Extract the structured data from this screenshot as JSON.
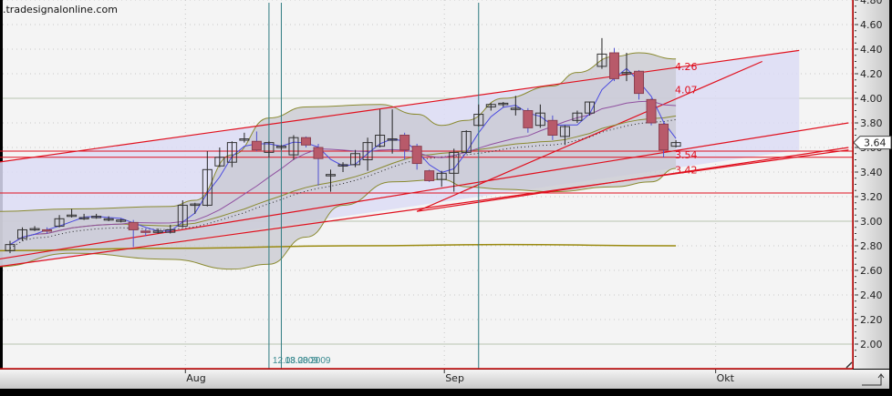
{
  "watermark": ".tradesignalonline.com",
  "chart_data": {
    "type": "candlestick",
    "y_axis": {
      "min": 1.8,
      "max": 4.8,
      "ticks": [
        2.0,
        2.2,
        2.4,
        2.6,
        2.8,
        3.0,
        3.2,
        3.4,
        3.6,
        3.8,
        4.0,
        4.2,
        4.4,
        4.6,
        4.8
      ],
      "position": "right"
    },
    "x_axis": {
      "month_labels": [
        {
          "label": "Aug",
          "date": "2009-08-03"
        },
        {
          "label": "Sep",
          "date": "2009-09-01"
        },
        {
          "label": "Okt",
          "date": "2009-10-01"
        }
      ]
    },
    "last_price": "3.64",
    "colors": {
      "bull": "#ffffff00",
      "bear": "#b85a6a",
      "trend": "#e0101e",
      "vline": "#2e7a80",
      "bb_fill": "#c8c8d0",
      "channel_fill": "#dcdcf5",
      "ma_fast": "#4a4ae0",
      "ma_mid": "#9050a0",
      "ma_slow": "#8a8a30"
    },
    "candles": [
      {
        "d": "2009-07-14",
        "ohlc": [
          2.76,
          2.84,
          2.74,
          2.81
        ]
      },
      {
        "d": "2009-07-15",
        "ohlc": [
          2.86,
          2.95,
          2.84,
          2.93
        ]
      },
      {
        "d": "2009-07-16",
        "ohlc": [
          2.93,
          2.96,
          2.92,
          2.94
        ]
      },
      {
        "d": "2009-07-17",
        "ohlc": [
          2.93,
          2.95,
          2.9,
          2.92
        ]
      },
      {
        "d": "2009-07-20",
        "ohlc": [
          2.96,
          3.05,
          2.95,
          3.02
        ]
      },
      {
        "d": "2009-07-21",
        "ohlc": [
          3.04,
          3.1,
          3.03,
          3.05
        ]
      },
      {
        "d": "2009-07-22",
        "ohlc": [
          3.03,
          3.06,
          3.01,
          3.03
        ]
      },
      {
        "d": "2009-07-23",
        "ohlc": [
          3.03,
          3.06,
          3.02,
          3.04
        ]
      },
      {
        "d": "2009-07-24",
        "ohlc": [
          3.02,
          3.04,
          3.0,
          3.02
        ]
      },
      {
        "d": "2009-07-27",
        "ohlc": [
          3.01,
          3.02,
          2.99,
          3.01
        ]
      },
      {
        "d": "2009-07-28",
        "ohlc": [
          2.99,
          3.01,
          2.79,
          2.93
        ]
      },
      {
        "d": "2009-07-29",
        "ohlc": [
          2.92,
          2.94,
          2.88,
          2.91
        ]
      },
      {
        "d": "2009-07-30",
        "ohlc": [
          2.91,
          2.94,
          2.9,
          2.92
        ]
      },
      {
        "d": "2009-07-31",
        "ohlc": [
          2.91,
          2.97,
          2.9,
          2.93
        ]
      },
      {
        "d": "2009-08-03",
        "ohlc": [
          2.96,
          3.17,
          2.95,
          3.13
        ]
      },
      {
        "d": "2009-08-04",
        "ohlc": [
          3.13,
          3.15,
          3.06,
          3.14
        ]
      },
      {
        "d": "2009-08-05",
        "ohlc": [
          3.13,
          3.57,
          3.12,
          3.42
        ]
      },
      {
        "d": "2009-08-06",
        "ohlc": [
          3.45,
          3.6,
          3.44,
          3.52
        ]
      },
      {
        "d": "2009-08-07",
        "ohlc": [
          3.48,
          3.65,
          3.44,
          3.64
        ]
      },
      {
        "d": "2009-08-10",
        "ohlc": [
          3.66,
          3.72,
          3.64,
          3.67
        ]
      },
      {
        "d": "2009-08-11",
        "ohlc": [
          3.65,
          3.73,
          3.57,
          3.58
        ]
      },
      {
        "d": "2009-08-12",
        "ohlc": [
          3.56,
          3.65,
          3.52,
          3.64
        ]
      },
      {
        "d": "2009-08-13",
        "ohlc": [
          3.61,
          3.62,
          3.58,
          3.61
        ]
      },
      {
        "d": "2009-08-14",
        "ohlc": [
          3.54,
          3.7,
          3.5,
          3.68
        ]
      },
      {
        "d": "2009-08-17",
        "ohlc": [
          3.68,
          3.69,
          3.6,
          3.62
        ]
      },
      {
        "d": "2009-08-18",
        "ohlc": [
          3.6,
          3.63,
          3.29,
          3.51
        ]
      },
      {
        "d": "2009-08-19",
        "ohlc": [
          3.38,
          3.42,
          3.24,
          3.38
        ]
      },
      {
        "d": "2009-08-20",
        "ohlc": [
          3.45,
          3.48,
          3.4,
          3.46
        ]
      },
      {
        "d": "2009-08-21",
        "ohlc": [
          3.46,
          3.58,
          3.44,
          3.55
        ]
      },
      {
        "d": "2009-08-24",
        "ohlc": [
          3.5,
          3.68,
          3.41,
          3.64
        ]
      },
      {
        "d": "2009-08-25",
        "ohlc": [
          3.61,
          3.91,
          3.6,
          3.7
        ]
      },
      {
        "d": "2009-08-26",
        "ohlc": [
          3.67,
          3.91,
          3.55,
          3.67
        ]
      },
      {
        "d": "2009-08-27",
        "ohlc": [
          3.7,
          3.72,
          3.5,
          3.58
        ]
      },
      {
        "d": "2009-08-28",
        "ohlc": [
          3.61,
          3.63,
          3.42,
          3.47
        ]
      },
      {
        "d": "2009-08-31",
        "ohlc": [
          3.41,
          3.42,
          3.32,
          3.33
        ]
      },
      {
        "d": "2009-09-01",
        "ohlc": [
          3.34,
          3.41,
          3.28,
          3.39
        ]
      },
      {
        "d": "2009-09-02",
        "ohlc": [
          3.39,
          3.59,
          3.24,
          3.56
        ]
      },
      {
        "d": "2009-09-03",
        "ohlc": [
          3.56,
          3.74,
          3.55,
          3.73
        ]
      },
      {
        "d": "2009-09-04",
        "ohlc": [
          3.78,
          3.95,
          3.77,
          3.87
        ]
      },
      {
        "d": "2009-09-07",
        "ohlc": [
          3.93,
          3.96,
          3.9,
          3.95
        ]
      },
      {
        "d": "2009-09-08",
        "ohlc": [
          3.95,
          3.97,
          3.93,
          3.96
        ]
      },
      {
        "d": "2009-09-09",
        "ohlc": [
          3.92,
          4.02,
          3.86,
          3.92
        ]
      },
      {
        "d": "2009-09-10",
        "ohlc": [
          3.9,
          3.92,
          3.72,
          3.76
        ]
      },
      {
        "d": "2009-09-11",
        "ohlc": [
          3.78,
          3.95,
          3.76,
          3.88
        ]
      },
      {
        "d": "2009-09-14",
        "ohlc": [
          3.82,
          3.86,
          3.66,
          3.7
        ]
      },
      {
        "d": "2009-09-15",
        "ohlc": [
          3.69,
          3.78,
          3.62,
          3.77
        ]
      },
      {
        "d": "2009-09-16",
        "ohlc": [
          3.82,
          3.9,
          3.8,
          3.88
        ]
      },
      {
        "d": "2009-09-17",
        "ohlc": [
          3.88,
          3.97,
          3.86,
          3.97
        ]
      },
      {
        "d": "2009-09-18",
        "ohlc": [
          4.26,
          4.49,
          4.24,
          4.36
        ]
      },
      {
        "d": "2009-09-21",
        "ohlc": [
          4.37,
          4.41,
          4.14,
          4.16
        ]
      },
      {
        "d": "2009-09-22",
        "ohlc": [
          4.21,
          4.37,
          4.14,
          4.21
        ]
      },
      {
        "d": "2009-09-23",
        "ohlc": [
          4.22,
          4.23,
          3.99,
          4.04
        ]
      },
      {
        "d": "2009-09-24",
        "ohlc": [
          3.99,
          4.0,
          3.78,
          3.8
        ]
      },
      {
        "d": "2009-09-25",
        "ohlc": [
          3.79,
          3.8,
          3.52,
          3.58
        ]
      },
      {
        "d": "2009-09-28",
        "ohlc": [
          3.61,
          3.66,
          3.6,
          3.64
        ]
      }
    ],
    "bollinger_upper": [
      [
        "2009-07-13",
        3.08
      ],
      [
        "2009-07-21",
        3.1
      ],
      [
        "2009-07-31",
        3.12
      ],
      [
        "2009-08-04",
        3.17
      ],
      [
        "2009-08-07",
        3.54
      ],
      [
        "2009-08-12",
        3.84
      ],
      [
        "2009-08-17",
        3.93
      ],
      [
        "2009-08-25",
        3.95
      ],
      [
        "2009-08-28",
        3.87
      ],
      [
        "2009-09-01",
        3.78
      ],
      [
        "2009-09-03",
        3.82
      ],
      [
        "2009-09-08",
        4.0
      ],
      [
        "2009-09-14",
        4.1
      ],
      [
        "2009-09-16",
        4.21
      ],
      [
        "2009-09-21",
        4.34
      ],
      [
        "2009-09-23",
        4.37
      ],
      [
        "2009-09-28",
        4.32
      ]
    ],
    "bollinger_lower": [
      [
        "2009-07-13",
        2.63
      ],
      [
        "2009-07-21",
        2.74
      ],
      [
        "2009-07-31",
        2.69
      ],
      [
        "2009-08-07",
        2.61
      ],
      [
        "2009-08-12",
        2.65
      ],
      [
        "2009-08-17",
        2.87
      ],
      [
        "2009-08-20",
        3.13
      ],
      [
        "2009-08-26",
        3.32
      ],
      [
        "2009-09-01",
        3.34
      ],
      [
        "2009-09-03",
        3.28
      ],
      [
        "2009-09-08",
        3.26
      ],
      [
        "2009-09-14",
        3.24
      ],
      [
        "2009-09-21",
        3.28
      ],
      [
        "2009-09-24",
        3.32
      ],
      [
        "2009-09-28",
        3.43
      ]
    ],
    "long_ma": [
      [
        "2009-07-13",
        2.76
      ],
      [
        "2009-07-31",
        2.78
      ],
      [
        "2009-08-21",
        2.8
      ],
      [
        "2009-09-08",
        2.81
      ],
      [
        "2009-09-28",
        2.8
      ]
    ],
    "ma_periods": {
      "fast": 3,
      "mid": 10,
      "slow": 20
    },
    "channel": {
      "upper": [
        [
          "2009-07-13",
          3.48
        ],
        [
          "2009-10-12",
          4.39
        ]
      ],
      "lower": [
        [
          "2009-07-13",
          2.63
        ],
        [
          "2009-10-12",
          3.58
        ]
      ]
    },
    "trendlines": [
      [
        [
          "2009-07-13",
          3.48
        ],
        [
          "2009-10-12",
          4.39
        ]
      ],
      [
        [
          "2009-07-13",
          2.63
        ],
        [
          "2009-10-16",
          3.58
        ]
      ],
      [
        [
          "2009-07-13",
          2.69
        ],
        [
          "2009-10-16",
          3.8
        ]
      ],
      [
        [
          "2009-08-28",
          3.08
        ],
        [
          "2009-10-07",
          4.3
        ]
      ],
      [
        [
          "2009-08-28",
          3.08
        ],
        [
          "2009-10-16",
          3.6
        ]
      ]
    ],
    "horizontal_lines": [
      3.57,
      3.52,
      3.23
    ],
    "level_labels": [
      {
        "text": "4.26",
        "price": 4.26
      },
      {
        "text": "4.07",
        "price": 4.07
      },
      {
        "text": "3.54",
        "price": 3.54
      },
      {
        "text": "3.42",
        "price": 3.42
      }
    ],
    "vertical_markers": [
      {
        "date": "2009-08-12",
        "label": "12.08.2009"
      },
      {
        "date": "2009-08-13",
        "label": "13.08.2009"
      },
      {
        "date": "2009-09-04",
        "label": ""
      }
    ]
  }
}
